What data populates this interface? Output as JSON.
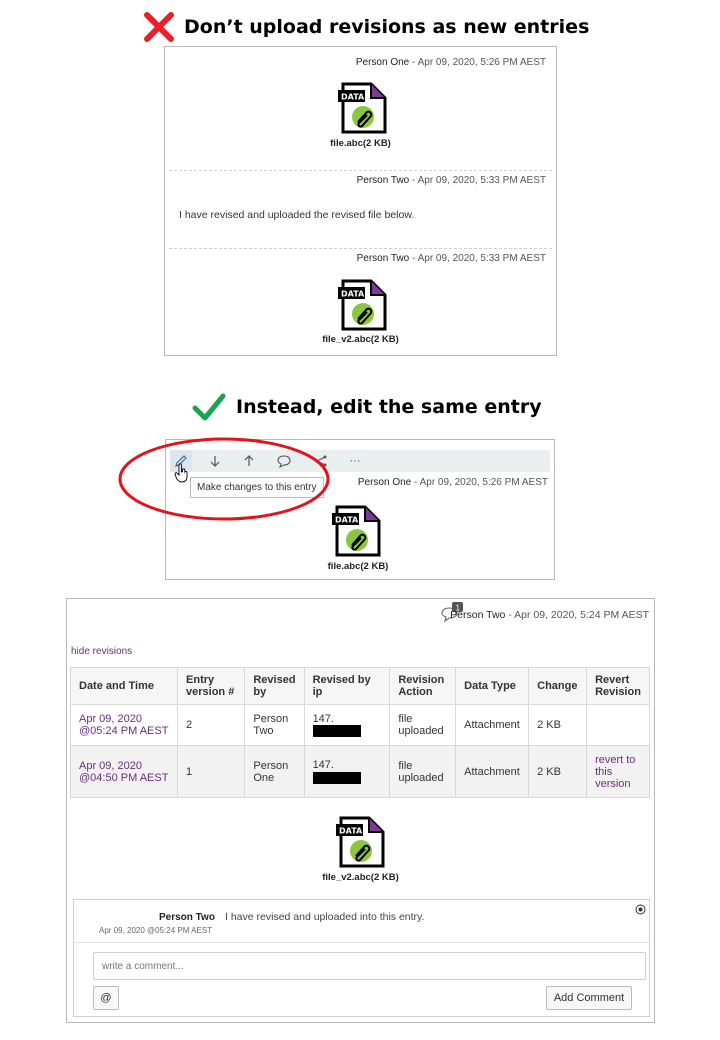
{
  "headings": {
    "dont": "Don’t upload revisions as new entries",
    "instead": "Instead, edit the same entry"
  },
  "colors": {
    "bad": "#e8202a",
    "good": "#19a44b",
    "highlight": "#e0141c",
    "revision_link": "#6a2f7a"
  },
  "panel_bad": {
    "entries": [
      {
        "author": "Person One",
        "meta": " - Apr 09, 2020, 5:26 PM AEST",
        "file": "file.abc(2 KB)"
      },
      {
        "author": "Person Two",
        "meta": " - Apr 09, 2020, 5:33 PM AEST",
        "text": "I have revised and uploaded the revised file below."
      },
      {
        "author": "Person Two",
        "meta": " - Apr 09, 2020, 5:33 PM AEST",
        "file": "file_v2.abc(2 KB)"
      }
    ],
    "file_icon_label": "DATA"
  },
  "panel_good": {
    "toolbar_icons": [
      "pencil-icon",
      "arrow-down-icon",
      "arrow-up-icon",
      "comment-icon",
      "share-icon",
      "more-icon"
    ],
    "more_label": "···",
    "tooltip": "Make changes to this entry",
    "author": "Person One",
    "meta": " - Apr 09, 2020, 5:26 PM AEST",
    "file": "file.abc(2 KB)",
    "file_icon_label": "DATA"
  },
  "panel_detail": {
    "comment_count": "1",
    "author": "Person Two",
    "meta": " - Apr 09, 2020, 5:24 PM AEST",
    "hide_revisions": "hide revisions",
    "columns": [
      "Date and Time",
      "Entry version #",
      "Revised by",
      "Revised by ip",
      "Revision Action",
      "Data Type",
      "Change",
      "Revert Revision"
    ],
    "rows": [
      {
        "date": "Apr 09, 2020 @05:24 PM AEST",
        "version": "2",
        "by": "Person Two",
        "ip": "147.",
        "action": "file uploaded",
        "type": "Attachment",
        "change": "2 KB",
        "revert": ""
      },
      {
        "date": "Apr 09, 2020 @04:50 PM AEST",
        "version": "1",
        "by": "Person One",
        "ip": "147.",
        "action": "file uploaded",
        "type": "Attachment",
        "change": "2 KB",
        "revert": "revert to this version"
      }
    ],
    "file": "file_v2.abc(2 KB)",
    "file_icon_label": "DATA",
    "comment": {
      "author": "Person Two",
      "text": "I have revised and uploaded into this entry.",
      "time": "Apr 09, 2020 @05:24 PM AEST",
      "placeholder": "write a comment...",
      "mention_label": "@",
      "submit_label": "Add Comment"
    }
  }
}
